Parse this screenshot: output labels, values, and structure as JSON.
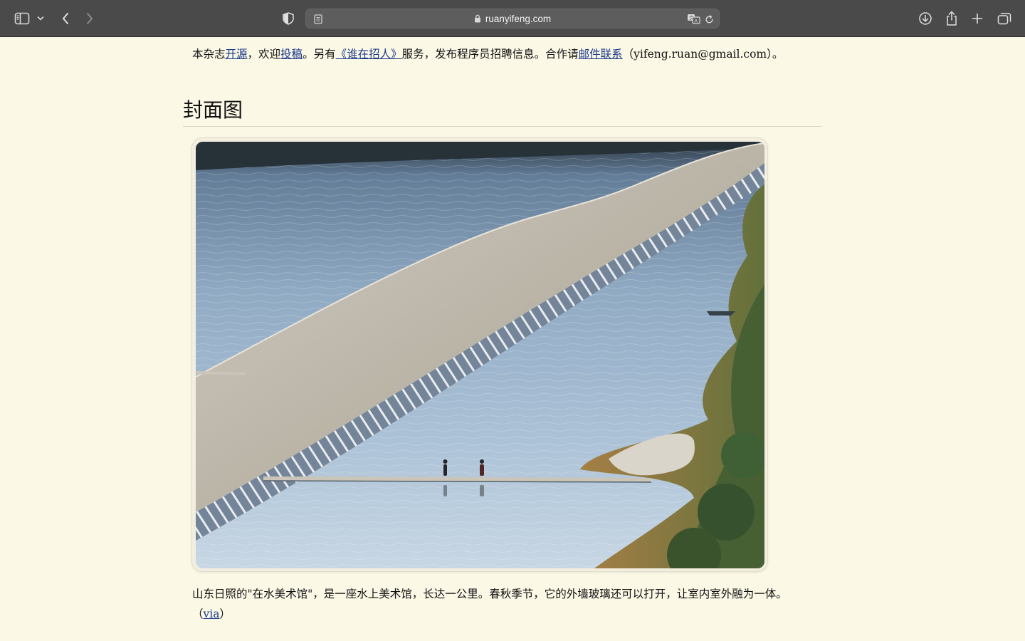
{
  "browser": {
    "url": "ruanyifeng.com",
    "icons": {
      "sidebar": "sidebar-icon",
      "tab_group_menu": "chevron-down-icon",
      "back": "chevron-left-icon",
      "forward": "chevron-right-icon",
      "privacy": "shield-icon",
      "reader": "reader-icon",
      "lock": "lock-icon",
      "translate": "translate-icon",
      "reload": "reload-icon",
      "downloads": "download-icon",
      "share": "share-icon",
      "new_tab": "plus-icon",
      "tab_overview": "tabs-icon"
    }
  },
  "notice": {
    "text_1": "本杂志",
    "link_open_source": "开源",
    "text_2": "，欢迎",
    "link_submit": "投稿",
    "text_3": "。另有",
    "link_hiring": "《谁在招人》",
    "text_4": "服务，发布程序员招聘信息。合作请",
    "link_email": "邮件联系",
    "text_5": "（yifeng.ruan@gmail.com）。"
  },
  "section": {
    "title": "封面图"
  },
  "figure": {
    "caption": "山东日照的\"在水美术馆\"，是一座水上美术馆，长达一公里。春秋季节，它的外墙玻璃还可以打开，让室内室外融为一体。",
    "via_open": "（",
    "via_link": "via",
    "via_close": "）"
  },
  "colors": {
    "page_background": "#fbf8e6",
    "toolbar": "#4a4a4a",
    "link": "#1a3a8a"
  }
}
